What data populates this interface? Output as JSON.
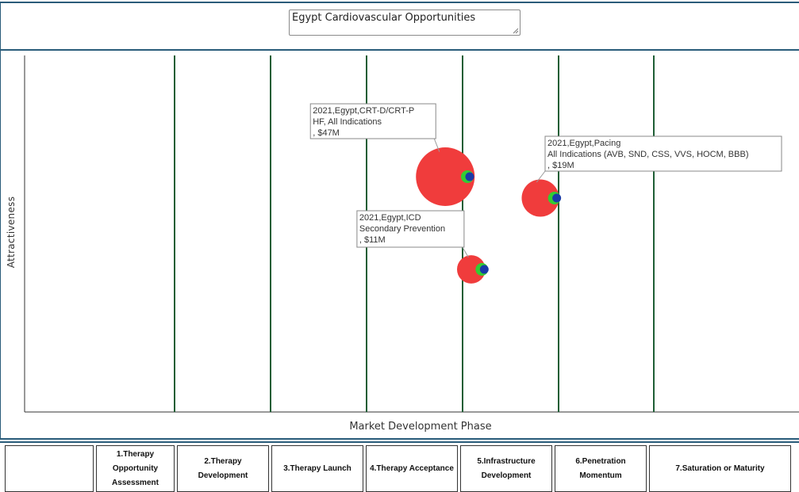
{
  "header": {
    "title_value": "Egypt Cardiovascular Opportunities"
  },
  "chart_data": {
    "type": "bubble",
    "title": "Egypt Cardiovascular Opportunities",
    "xlabel": "Market Development Phase",
    "ylabel": "Attractiveness",
    "phases": [
      "",
      "1.Therapy Opportunity Assessment",
      "2.Therapy Development",
      "3.Therapy Launch",
      "4.Therapy Acceptance",
      "5.Infrastructure Development",
      "6.Penetration Momentum",
      "7.Saturation or Maturity"
    ],
    "bubbles": [
      {
        "label_lines": [
          "2021,Egypt,CRT-D/CRT-P",
          "HF, All Indications",
          ", $47M"
        ],
        "value_musd": 47,
        "phase_position": 3.82,
        "attractiveness": 0.66,
        "color": "#f03c3c"
      },
      {
        "label_lines": [
          "2021,Egypt,Pacing",
          "All Indications (AVB, SND, CSS, VVS, HOCM, BBB)",
          ", $19M"
        ],
        "value_musd": 19,
        "phase_position": 4.81,
        "attractiveness": 0.6,
        "color": "#f03c3c"
      },
      {
        "label_lines": [
          "2021,Egypt,ICD",
          "Secondary Prevention",
          ", $11M"
        ],
        "value_musd": 11,
        "phase_position": 4.09,
        "attractiveness": 0.4,
        "color": "#f03c3c"
      }
    ],
    "marker_colors": {
      "outer": "#f03c3c",
      "ring": "#33cc33",
      "center": "#1a3aa8"
    },
    "grid": true
  },
  "colors": {
    "panel_border": "#2a5c7a",
    "phase_line": "#1f5e35",
    "axis": "#333333"
  }
}
